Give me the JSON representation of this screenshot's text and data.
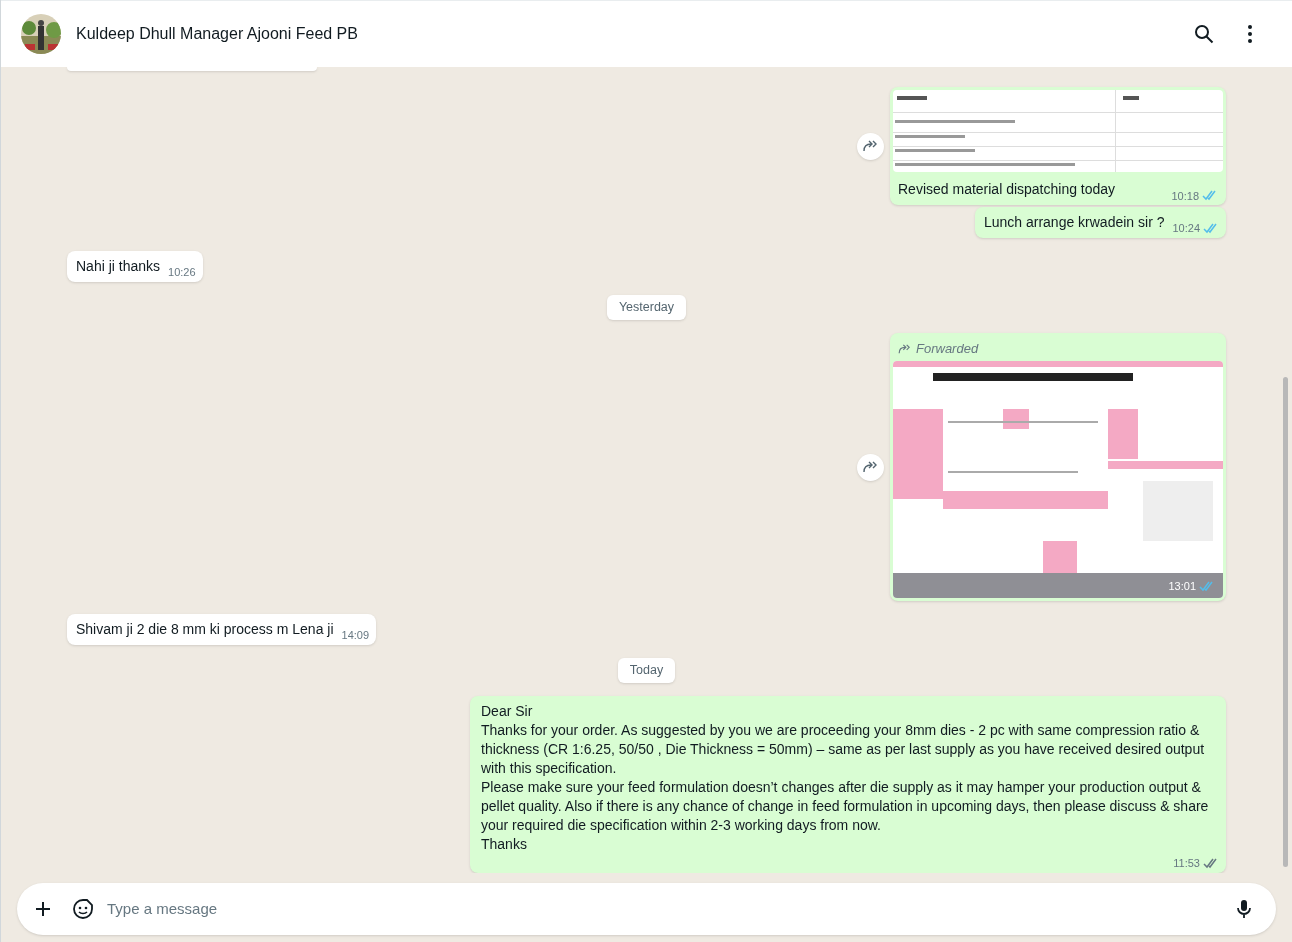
{
  "header": {
    "contact_name": "Kuldeep Dhull Manager Ajooni Feed PB"
  },
  "messages": [
    {
      "outgoing": true,
      "caption": "Revised material dispatching today",
      "time": "10:18",
      "read": true
    },
    {
      "kind": "text",
      "outgoing": true,
      "text": "Lunch arrange krwadein sir ?",
      "time": "10:24",
      "read": true
    },
    {
      "kind": "text",
      "outgoing": false,
      "text": "Nahi ji thanks",
      "time": "10:26"
    },
    {
      "kind": "date",
      "label": "Yesterday"
    },
    {
      "outgoing": true,
      "forwarded_label": "Forwarded",
      "time": "13:01",
      "read": true
    },
    {
      "kind": "text",
      "outgoing": false,
      "text": "Shivam ji 2 die 8 mm ki process m Lena ji",
      "time": "14:09"
    },
    {
      "kind": "date",
      "label": "Today"
    },
    {
      "kind": "text",
      "outgoing": true,
      "text": "Dear Sir\nThanks for your order. As suggested by you we are proceeding your 8mm dies - 2 pc with same compression ratio & thickness (CR 1:6.25, 50/50 , Die Thickness = 50mm) – same as per last supply as you have received desired output with this specification.\nPlease make sure your feed formulation doesn’t changes after die supply as it may hamper your production output & pellet quality. Also if there is any chance of change in feed formulation in upcoming days, then please discuss & share your required die specification within 2-3 working days from now.\nThanks",
      "time": "11:53",
      "read": false
    }
  ],
  "composer": {
    "placeholder": "Type a message"
  }
}
